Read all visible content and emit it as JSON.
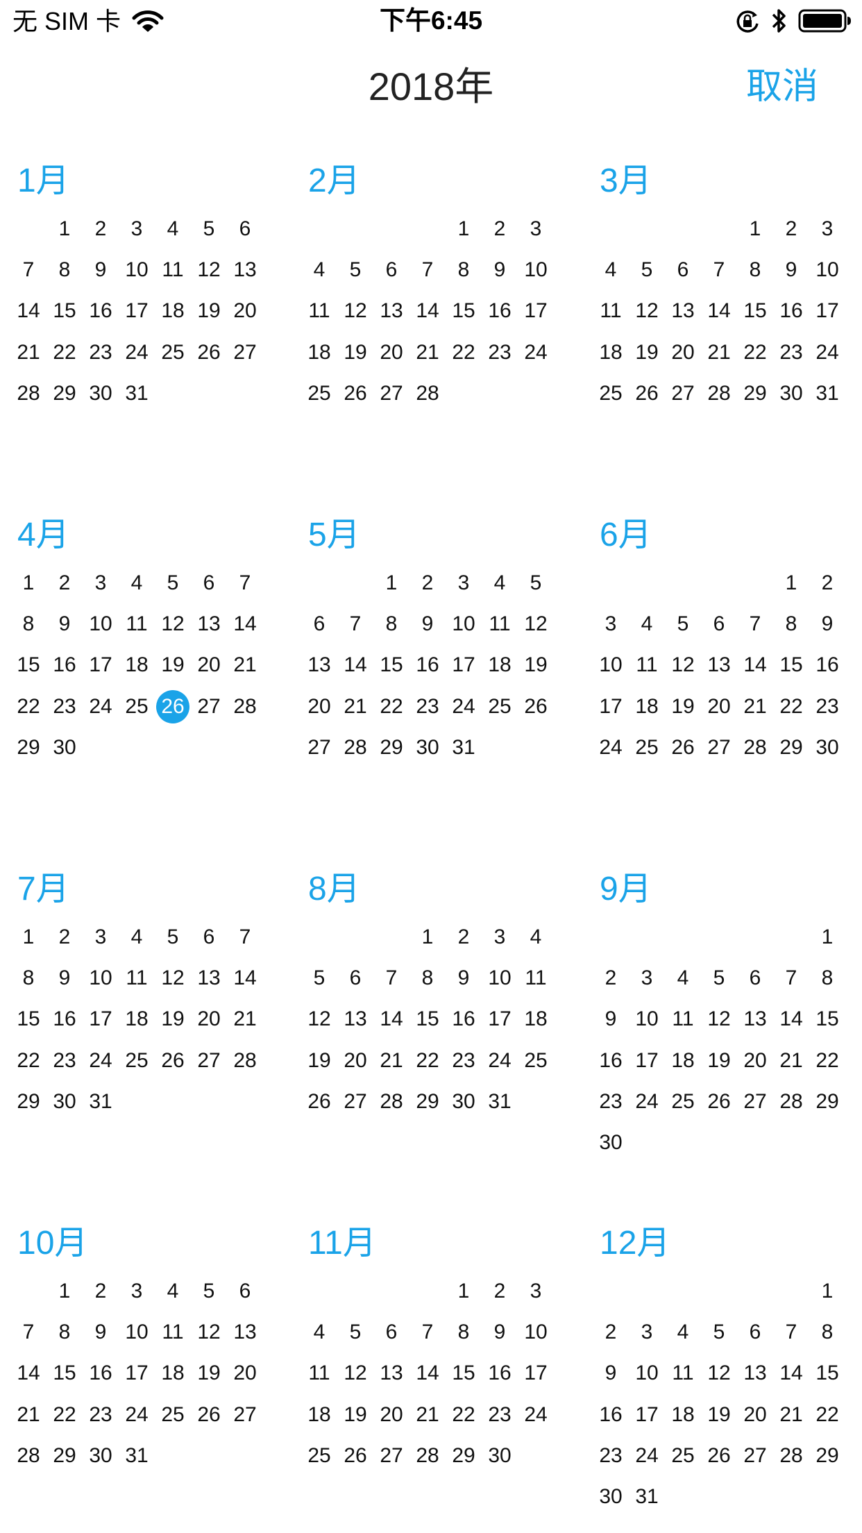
{
  "status_bar": {
    "carrier": "无 SIM 卡",
    "time": "下午6:45",
    "icons": [
      "wifi-icon",
      "orientation-lock-icon",
      "bluetooth-icon",
      "battery-icon"
    ]
  },
  "header": {
    "title": "2018年",
    "cancel_label": "取消"
  },
  "colors": {
    "accent": "#1aa3e8",
    "text": "#111111",
    "title": "#222222"
  },
  "today": {
    "month": 4,
    "day": 26
  },
  "months": [
    {
      "label": "1月",
      "offset": 1,
      "days": 31
    },
    {
      "label": "2月",
      "offset": 4,
      "days": 28
    },
    {
      "label": "3月",
      "offset": 4,
      "days": 31
    },
    {
      "label": "4月",
      "offset": 0,
      "days": 30
    },
    {
      "label": "5月",
      "offset": 2,
      "days": 31
    },
    {
      "label": "6月",
      "offset": 5,
      "days": 30
    },
    {
      "label": "7月",
      "offset": 0,
      "days": 31
    },
    {
      "label": "8月",
      "offset": 3,
      "days": 31
    },
    {
      "label": "9月",
      "offset": 6,
      "days": 30
    },
    {
      "label": "10月",
      "offset": 1,
      "days": 31
    },
    {
      "label": "11月",
      "offset": 4,
      "days": 30
    },
    {
      "label": "12月",
      "offset": 6,
      "days": 31
    }
  ]
}
